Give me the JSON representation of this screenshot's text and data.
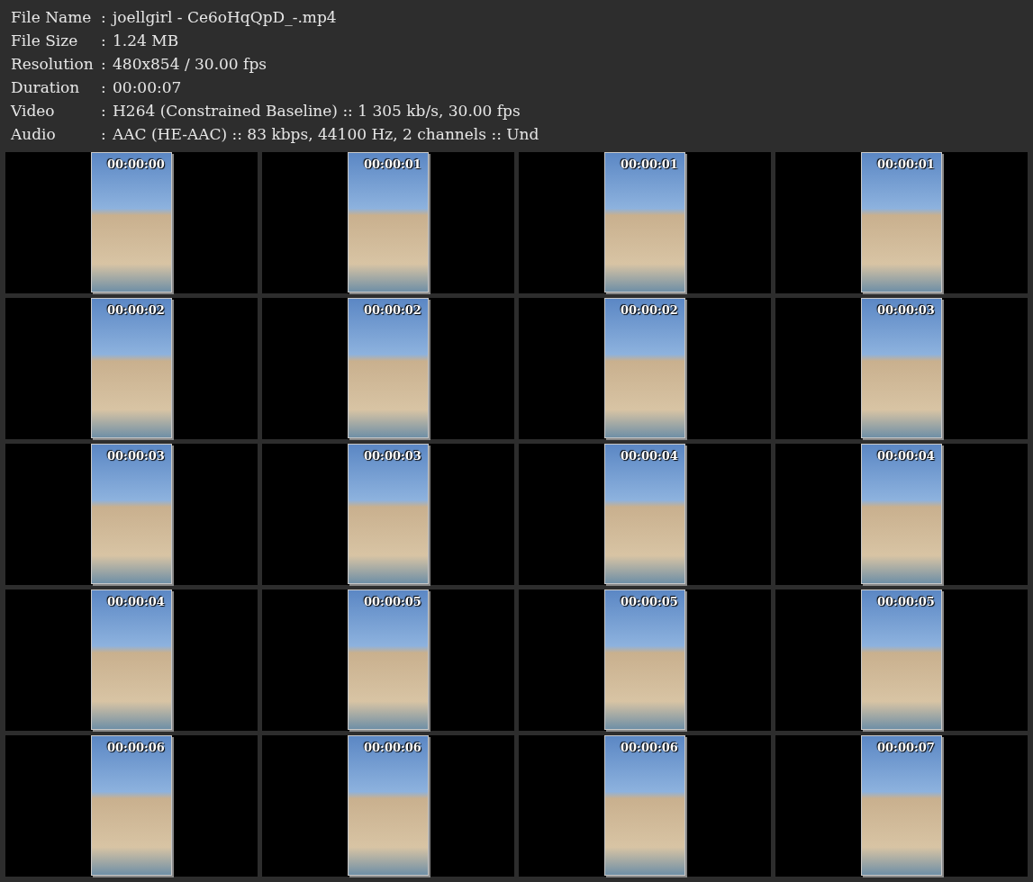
{
  "info": [
    {
      "label": "File Name",
      "value": "joellgirl - Ce6oHqQpD_-.mp4"
    },
    {
      "label": "File Size",
      "value": "1.24 MB"
    },
    {
      "label": "Resolution",
      "value": "480x854 / 30.00 fps"
    },
    {
      "label": "Duration",
      "value": "00:00:07"
    },
    {
      "label": "Video",
      "value": "H264 (Constrained Baseline) :: 1 305 kb/s, 30.00 fps"
    },
    {
      "label": "Audio",
      "value": "AAC (HE-AAC) :: 83 kbps, 44100 Hz, 2 channels :: Und"
    }
  ],
  "separator": ":",
  "frames": [
    {
      "time": "00:00:00"
    },
    {
      "time": "00:00:01"
    },
    {
      "time": "00:00:01"
    },
    {
      "time": "00:00:01"
    },
    {
      "time": "00:00:02"
    },
    {
      "time": "00:00:02"
    },
    {
      "time": "00:00:02"
    },
    {
      "time": "00:00:03"
    },
    {
      "time": "00:00:03"
    },
    {
      "time": "00:00:03"
    },
    {
      "time": "00:00:04"
    },
    {
      "time": "00:00:04"
    },
    {
      "time": "00:00:04"
    },
    {
      "time": "00:00:05"
    },
    {
      "time": "00:00:05"
    },
    {
      "time": "00:00:05"
    },
    {
      "time": "00:00:06"
    },
    {
      "time": "00:00:06"
    },
    {
      "time": "00:00:06"
    },
    {
      "time": "00:00:07"
    }
  ]
}
